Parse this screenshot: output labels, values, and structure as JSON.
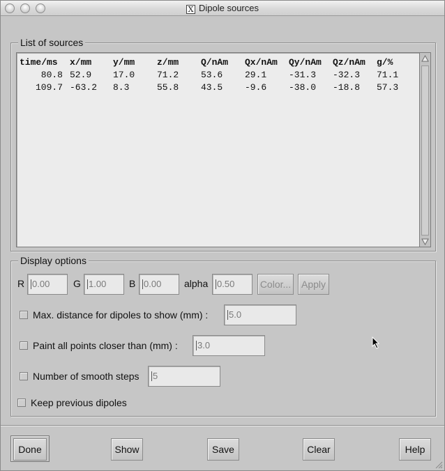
{
  "window": {
    "title": "Dipole sources"
  },
  "list_group": {
    "legend": "List of sources",
    "columns": [
      "time/ms",
      "x/mm",
      "y/mm",
      "z/mm",
      "Q/nAm",
      "Qx/nAm",
      "Qy/nAm",
      "Qz/nAm",
      "g/%"
    ],
    "rows": [
      [
        "80.8",
        "52.9",
        "17.0",
        "71.2",
        "53.6",
        "29.1",
        "-31.3",
        "-32.3",
        "71.1"
      ],
      [
        "109.7",
        "-63.2",
        "8.3",
        "55.8",
        "43.5",
        "-9.6",
        "-38.0",
        "-18.8",
        "57.3"
      ]
    ]
  },
  "display_group": {
    "legend": "Display options",
    "r_label": "R",
    "r_value": "0.00",
    "g_label": "G",
    "g_value": "1.00",
    "b_label": "B",
    "b_value": "0.00",
    "alpha_label": "alpha",
    "alpha_value": "0.50",
    "color_button": "Color...",
    "apply_button": "Apply",
    "max_distance_label": "Max. distance for dipoles to show (mm) :",
    "max_distance_value": "5.0",
    "paint_closer_label": "Paint all points closer than (mm) :",
    "paint_closer_value": "3.0",
    "smooth_steps_label": "Number of smooth steps",
    "smooth_steps_value": "5",
    "keep_previous_label": "Keep previous dipoles"
  },
  "buttons": {
    "done": "Done",
    "show": "Show",
    "save": "Save",
    "clear": "Clear",
    "help": "Help"
  }
}
